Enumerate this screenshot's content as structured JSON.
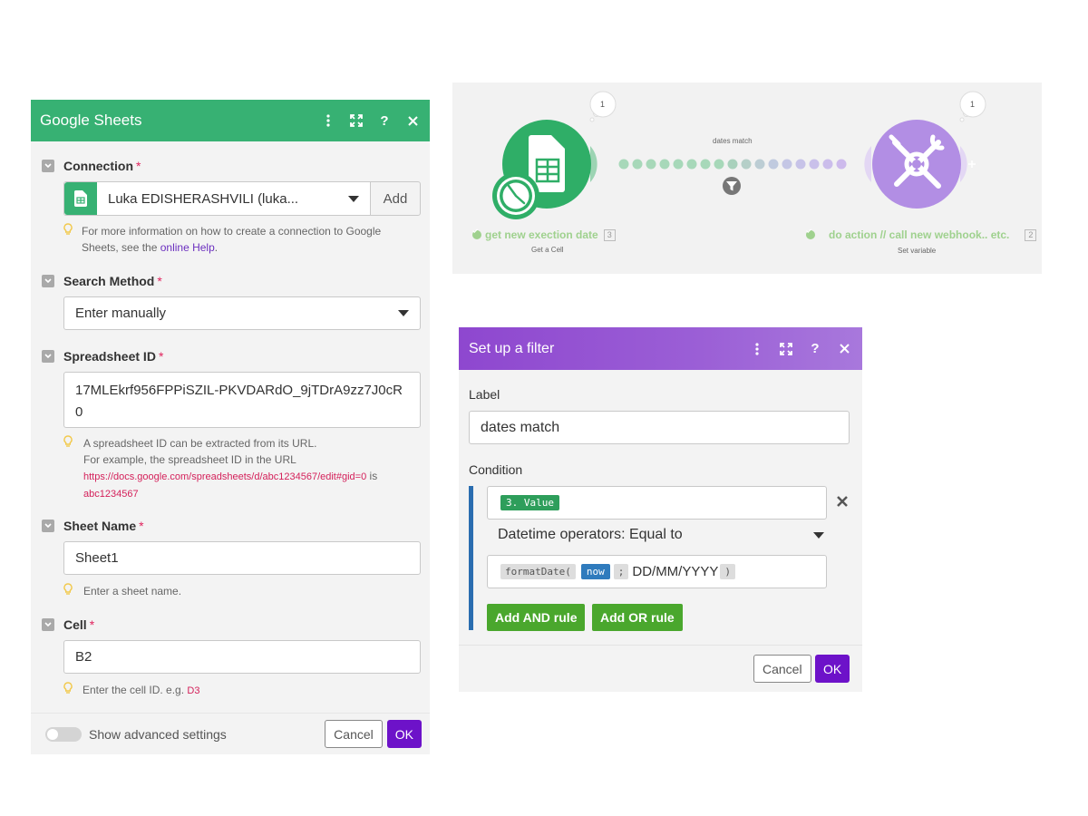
{
  "google_sheets": {
    "title": "Google Sheets",
    "connection": {
      "label": "Connection",
      "required_mark": "*",
      "value": "Luka EDISHERASHVILI (luka...",
      "add_label": "Add",
      "hint_text": "For more information on how to create a connection to Google Sheets, see the",
      "hint_link": "online Help",
      "hint_end": "."
    },
    "search_method": {
      "label": "Search Method",
      "required_mark": "*",
      "value": "Enter manually"
    },
    "spreadsheet_id": {
      "label": "Spreadsheet ID",
      "required_mark": "*",
      "value": "17MLEkrf956FPPiSZIL-PKVDARdO_9jTDrA9zz7J0cR0",
      "hint_line1": "A spreadsheet ID can be extracted from its URL.",
      "hint_line2": "For example, the spreadsheet ID in the URL",
      "hint_url": "https://docs.google.com/spreadsheets/d/abc1234567/edit#gid=0",
      "hint_is": "is",
      "hint_example": "abc1234567"
    },
    "sheet_name": {
      "label": "Sheet Name",
      "required_mark": "*",
      "value": "Sheet1",
      "hint": "Enter a sheet name."
    },
    "cell": {
      "label": "Cell",
      "required_mark": "*",
      "value": "B2",
      "hint": "Enter the cell ID. e.g.",
      "hint_example": "D3"
    },
    "footer": {
      "advanced_label": "Show advanced settings",
      "cancel_label": "Cancel",
      "ok_label": "OK"
    }
  },
  "scenario": {
    "module1": {
      "title": "get new exection date",
      "subtitle": "Get a Cell",
      "id": "3",
      "bubble": "1",
      "icon": "google-sheets-icon",
      "color": "#2fae67"
    },
    "module2": {
      "title": "do action // call new webhook.. etc.",
      "subtitle": "Set variable",
      "id": "2",
      "bubble": "1",
      "icon": "tools-icon",
      "color": "#b28ee4"
    },
    "route": {
      "label": "dates match",
      "icon": "filter-icon"
    }
  },
  "filter": {
    "title": "Set up a filter",
    "label_caption": "Label",
    "label_value": "dates match",
    "condition_caption": "Condition",
    "operand1": "3. Value",
    "operator": "Datetime operators: Equal to",
    "operand2": {
      "fn": "formatDate(",
      "arg": "now",
      "sep": ";",
      "format": "DD/MM/YYYY",
      "close": ")"
    },
    "add_and_label": "Add AND rule",
    "add_or_label": "Add OR rule",
    "cancel_label": "Cancel",
    "ok_label": "OK"
  }
}
